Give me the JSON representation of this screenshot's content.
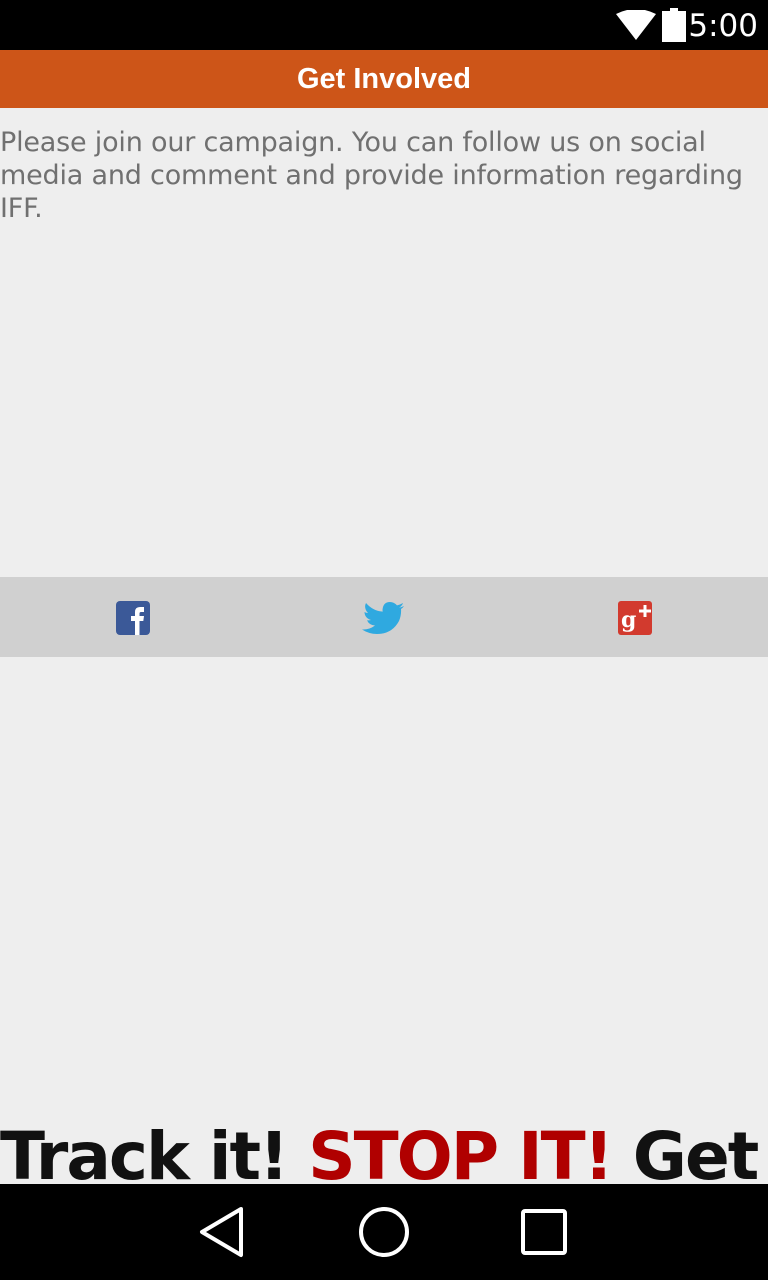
{
  "status_bar": {
    "time": "5:00",
    "icons": [
      "wifi-icon",
      "battery-icon"
    ]
  },
  "header": {
    "title": "Get Involved",
    "background_color": "#cd5518"
  },
  "intro": {
    "text": "Please join our campaign. You can follow us on social media and comment and provide information regarding IFF."
  },
  "social": {
    "items": [
      {
        "icon": "facebook-icon",
        "color": "#3b5998"
      },
      {
        "icon": "twitter-icon",
        "color": "#2fa9e0"
      },
      {
        "icon": "google-plus-icon",
        "color": "#d23a2e"
      }
    ]
  },
  "tagline": {
    "part1": "Track it!",
    "part2": "STOP IT!",
    "part3": "Get it!",
    "accent_color": "#b00000"
  },
  "nav_bar": {
    "icons": [
      "back-icon",
      "home-icon",
      "recent-apps-icon"
    ]
  }
}
